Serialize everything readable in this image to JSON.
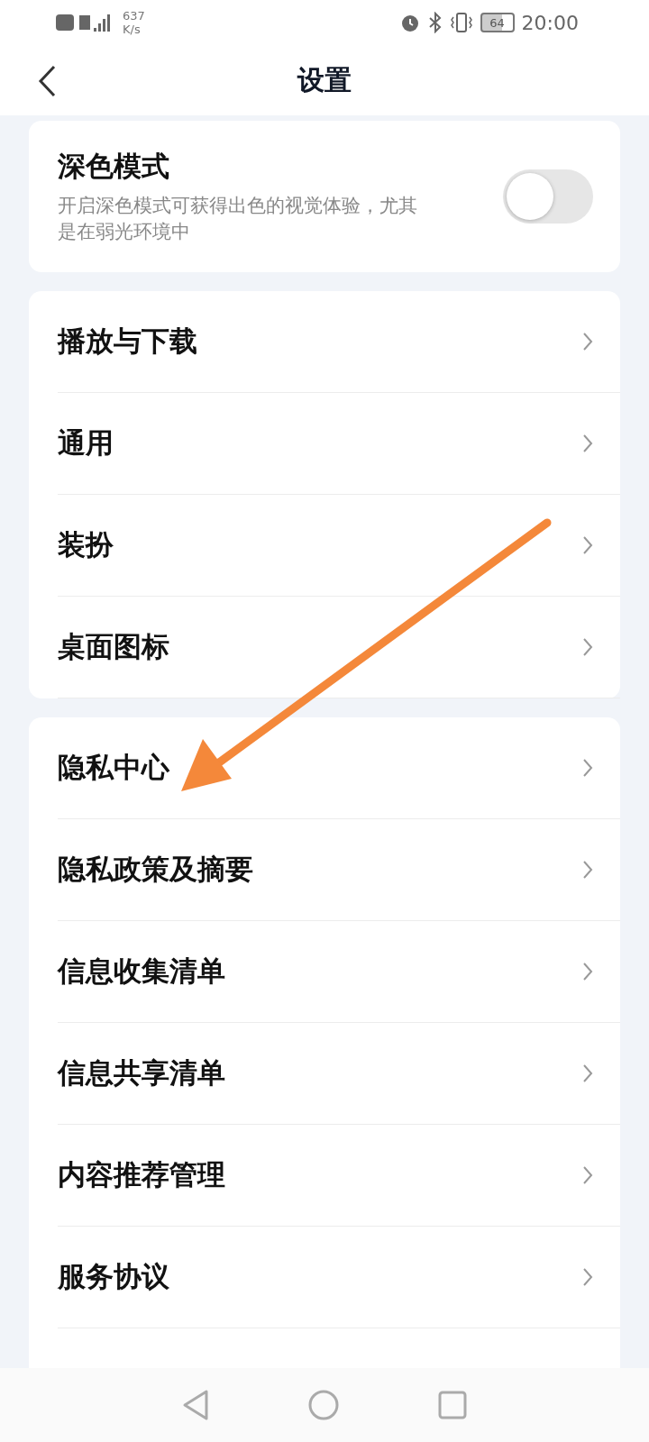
{
  "status_bar": {
    "network_speed": "637",
    "network_unit": "K/s",
    "battery": "64",
    "time": "20:00"
  },
  "header": {
    "title": "设置"
  },
  "dark_mode": {
    "title": "深色模式",
    "description": "开启深色模式可获得出色的视觉体验，尤其是在弱光环境中",
    "on": false
  },
  "groups": [
    {
      "items": [
        {
          "label": "播放与下载"
        },
        {
          "label": "通用"
        },
        {
          "label": "装扮"
        },
        {
          "label": "桌面图标"
        }
      ]
    },
    {
      "items": [
        {
          "label": "隐私中心"
        },
        {
          "label": "隐私政策及摘要"
        },
        {
          "label": "信息收集清单"
        },
        {
          "label": "信息共享清单"
        },
        {
          "label": "内容推荐管理"
        },
        {
          "label": "服务协议"
        }
      ]
    }
  ]
}
